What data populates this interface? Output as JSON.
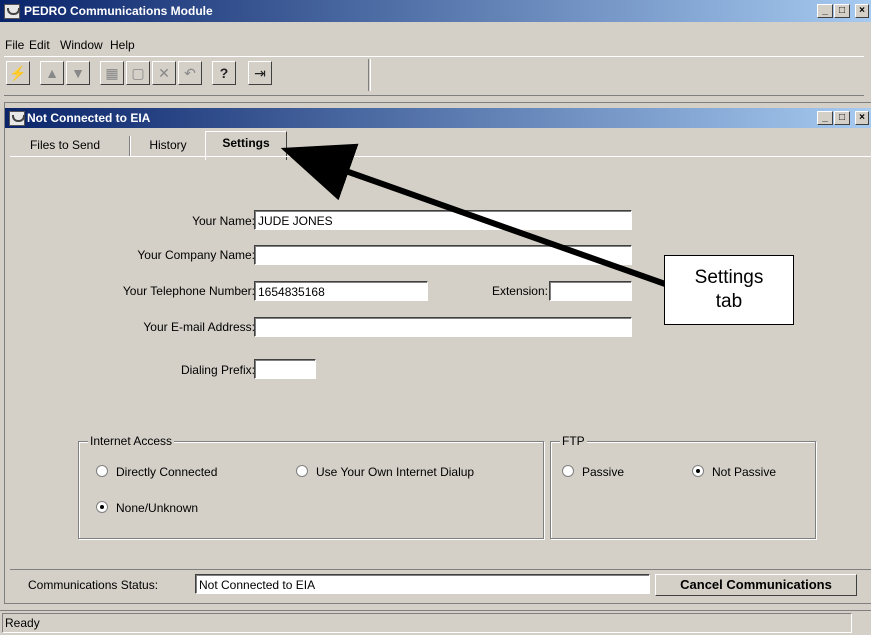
{
  "app": {
    "title": "PEDRO Communications Module"
  },
  "menu": {
    "file": "File",
    "edit": "Edit",
    "window": "Window",
    "help": "Help"
  },
  "toolbar": {
    "buttons": [
      {
        "icon": "connect-icon",
        "glyph": "⚡"
      },
      {
        "icon": "move-up-icon",
        "glyph": "▲"
      },
      {
        "icon": "move-down-icon",
        "glyph": "▼"
      },
      {
        "icon": "grid-icon",
        "glyph": "▦"
      },
      {
        "icon": "new-page-icon",
        "glyph": "▢"
      },
      {
        "icon": "delete-icon",
        "glyph": "✕"
      },
      {
        "icon": "undo-icon",
        "glyph": "↶"
      },
      {
        "icon": "help-icon",
        "glyph": "?"
      },
      {
        "icon": "exit-icon",
        "glyph": "⇥"
      }
    ]
  },
  "child": {
    "title": "Not Connected to EIA"
  },
  "tabs": {
    "files": "Files to Send",
    "history": "History",
    "settings": "Settings"
  },
  "form": {
    "name_label": "Your Name:",
    "name_value": "JUDE JONES",
    "company_label": "Your Company Name:",
    "company_value": "",
    "phone_label": "Your Telephone Number:",
    "phone_value": "1654835168",
    "ext_label": "Extension:",
    "ext_value": "",
    "email_label": "Your E-mail Address:",
    "email_value": "",
    "prefix_label": "Dialing Prefix:",
    "prefix_value": ""
  },
  "internet": {
    "title": "Internet Access",
    "direct": "Directly Connected",
    "dialup": "Use Your Own Internet Dialup",
    "none": "None/Unknown",
    "selected": "none"
  },
  "ftp": {
    "title": "FTP",
    "passive": "Passive",
    "not_passive": "Not Passive",
    "selected": "not_passive"
  },
  "comm": {
    "label": "Communications Status:",
    "value": "Not Connected to EIA",
    "cancel": "Cancel Communications"
  },
  "statusbar": {
    "text": "Ready"
  },
  "callout": {
    "line1": "Settings",
    "line2": "tab"
  }
}
